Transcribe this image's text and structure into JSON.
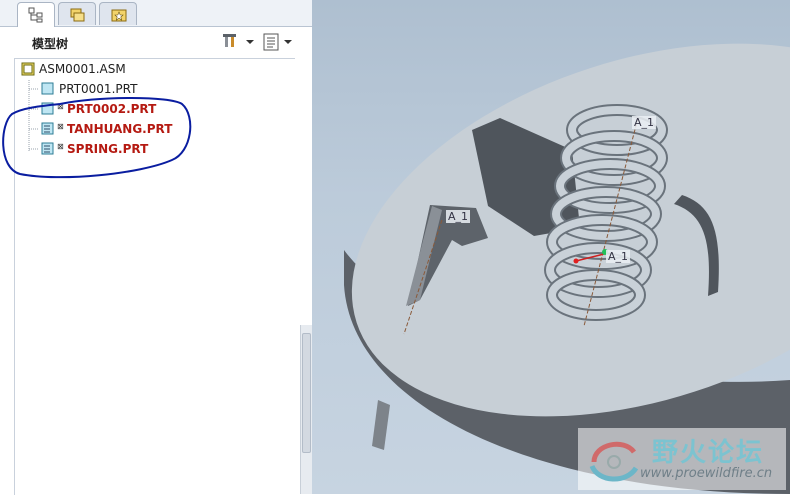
{
  "panel": {
    "title": "模型树",
    "tabs": [
      {
        "name": "model-tree-tab",
        "active": true
      },
      {
        "name": "folder-browser-tab",
        "active": false
      },
      {
        "name": "favorites-tab",
        "active": false
      }
    ]
  },
  "tree": {
    "root": {
      "label": "ASM0001.ASM",
      "icon": "assembly-icon"
    },
    "items": [
      {
        "label": "PRT0001.PRT",
        "icon": "part-icon",
        "missing": false
      },
      {
        "label": "PRT0002.PRT",
        "icon": "part-icon",
        "missing": true
      },
      {
        "label": "TANHUANG.PRT",
        "icon": "flexible-part-icon",
        "missing": true
      },
      {
        "label": "SPRING.PRT",
        "icon": "flexible-part-icon",
        "missing": true
      }
    ]
  },
  "viewport": {
    "datum_labels": [
      "A_1",
      "A_1",
      "A_1"
    ]
  },
  "watermark": {
    "brand": "野火论坛",
    "url": "www.proewildfire.cn"
  },
  "colors": {
    "missing_text": "#b51a12",
    "annotation": "#0a1da0"
  }
}
